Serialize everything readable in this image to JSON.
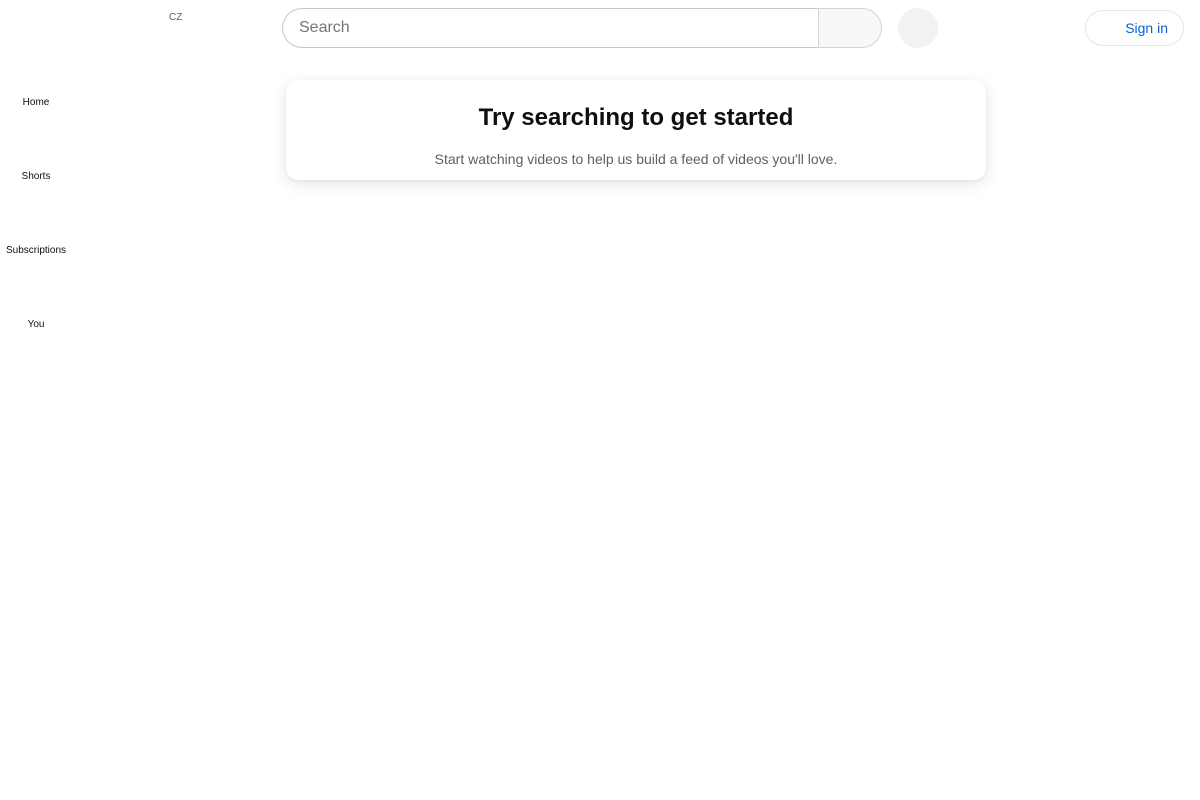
{
  "masthead": {
    "country_code": "CZ",
    "search": {
      "placeholder": "Search",
      "value": ""
    },
    "sign_in_label": "Sign in"
  },
  "guide": {
    "items": [
      {
        "label": "Home"
      },
      {
        "label": "Shorts"
      },
      {
        "label": "Subscriptions"
      },
      {
        "label": "You"
      }
    ]
  },
  "main": {
    "prompt_title": "Try searching to get started",
    "prompt_subtitle": "Start watching videos to help us build a feed of videos you'll love."
  },
  "colors": {
    "link_blue": "#065fd4",
    "text_primary": "#0f0f0f",
    "text_secondary": "#606060"
  }
}
